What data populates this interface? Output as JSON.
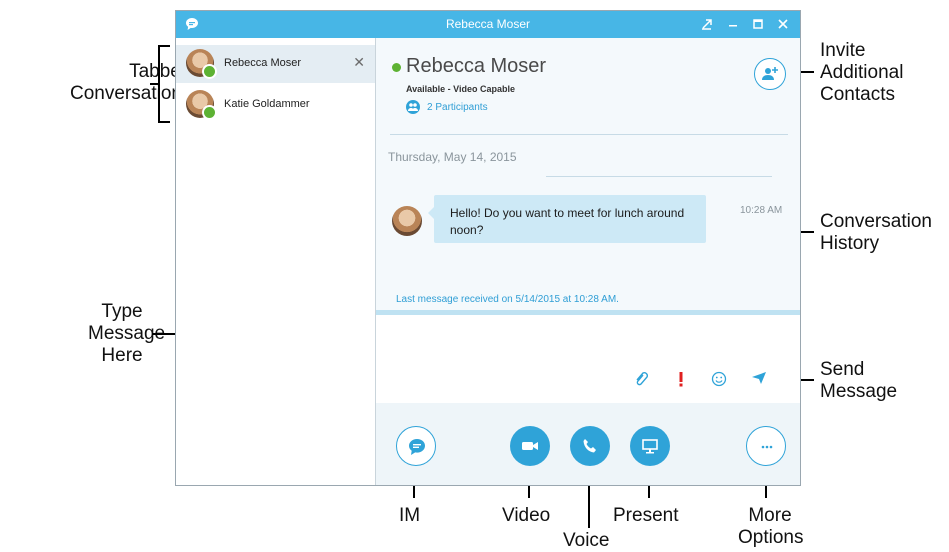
{
  "annotations": {
    "tabbed_conversations": [
      "Tabbed",
      "Conversations"
    ],
    "type_message_here": [
      "Type",
      "Message",
      "Here"
    ],
    "invite_additional_contacts": [
      "Invite",
      "Additional",
      "Contacts"
    ],
    "conversation_history": [
      "Conversation",
      "History"
    ],
    "send_message": [
      "Send",
      "Message"
    ],
    "im": "IM",
    "video": "Video",
    "voice": "Voice",
    "present": "Present",
    "more_options": [
      "More",
      "Options"
    ]
  },
  "window": {
    "title": "Rebecca Moser"
  },
  "tabs": [
    {
      "name": "Rebecca Moser",
      "close": "✕"
    },
    {
      "name": "Katie Goldammer"
    }
  ],
  "conversation": {
    "contact_name": "Rebecca Moser",
    "status": "Available - Video Capable",
    "participants": "2 Participants",
    "date": "Thursday, May 14, 2015",
    "message_text": "Hello! Do you want to meet for lunch around noon?",
    "message_time": "10:28 AM",
    "last_received": "Last message received on 5/14/2015 at 10:28 AM."
  },
  "colors": {
    "accent": "#2fa3d8",
    "titlebar": "#47b6e6",
    "presence_available": "#5db233",
    "urgent": "#e02020",
    "bubble": "#cde9f6"
  },
  "icons": {
    "app": "chat-bubble-icon",
    "attach": "paperclip-icon",
    "important": "exclamation-icon",
    "emoticon": "smiley-icon",
    "send": "send-arrow-icon",
    "invite": "add-person-icon",
    "im": "chat-bubble-icon",
    "video": "video-camera-icon",
    "voice": "phone-icon",
    "present": "monitor-icon",
    "more": "ellipsis-icon"
  }
}
